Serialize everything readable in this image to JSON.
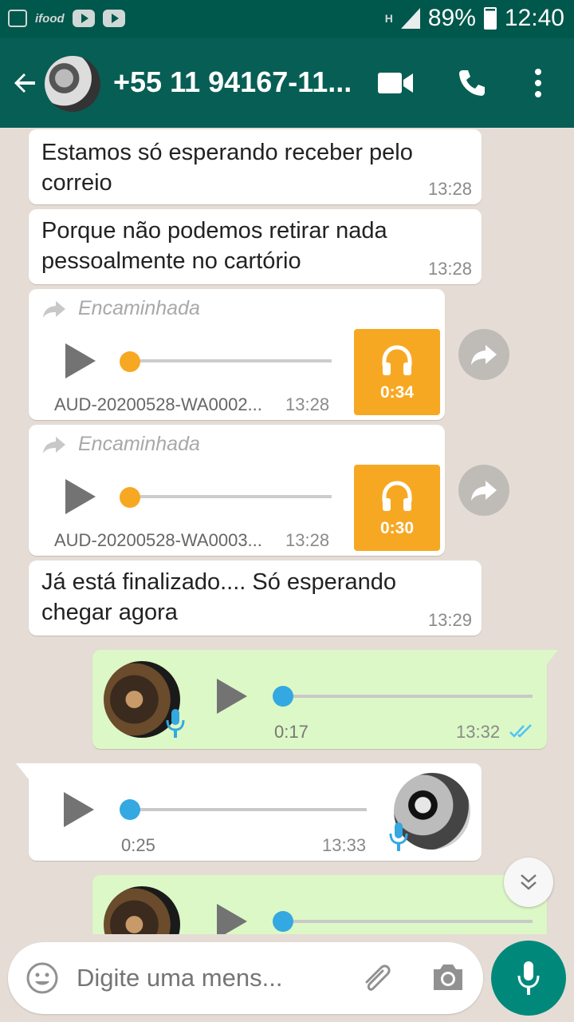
{
  "status_bar": {
    "left_icons": [
      "image-icon",
      "ifood-icon",
      "youtube-icon",
      "youtube-icon"
    ],
    "ifood_text": "ifood",
    "network": "H",
    "battery": "89%",
    "time": "12:40"
  },
  "header": {
    "contact_name": "+55 11 94167-11...",
    "icons": [
      "back-arrow-icon",
      "video-call-icon",
      "phone-icon",
      "more-options-icon"
    ]
  },
  "messages": [
    {
      "type": "text",
      "direction": "incoming",
      "text": "Estamos só esperando receber pelo correio",
      "time": "13:28"
    },
    {
      "type": "text",
      "direction": "incoming",
      "text": "Porque não podemos retirar nada pessoalmente no cartório",
      "time": "13:28"
    },
    {
      "type": "forwarded-audio",
      "direction": "incoming",
      "forward_label": "Encaminhada",
      "filename": "AUD-20200528-WA0002...",
      "time": "13:28",
      "duration": "0:34",
      "progress": 0
    },
    {
      "type": "forwarded-audio",
      "direction": "incoming",
      "forward_label": "Encaminhada",
      "filename": "AUD-20200528-WA0003...",
      "time": "13:28",
      "duration": "0:30",
      "progress": 0
    },
    {
      "type": "text",
      "direction": "incoming",
      "text": "Já está finalizado.... Só esperando chegar agora",
      "time": "13:29"
    },
    {
      "type": "voice",
      "direction": "outgoing",
      "duration": "0:17",
      "time": "13:32",
      "status": "read",
      "progress": 0
    },
    {
      "type": "voice",
      "direction": "incoming",
      "duration": "0:25",
      "time": "13:33",
      "progress": 0
    },
    {
      "type": "voice",
      "direction": "outgoing",
      "duration": "",
      "time": "",
      "progress": 0
    }
  ],
  "composer": {
    "placeholder": "Digite uma mens..."
  },
  "colors": {
    "header": "#075e54",
    "status_bar": "#00574b",
    "outgoing_bubble": "#dcf8c6",
    "audio_accent": "#f7a823",
    "voice_accent": "#34a8e0",
    "fab": "#00897b"
  }
}
